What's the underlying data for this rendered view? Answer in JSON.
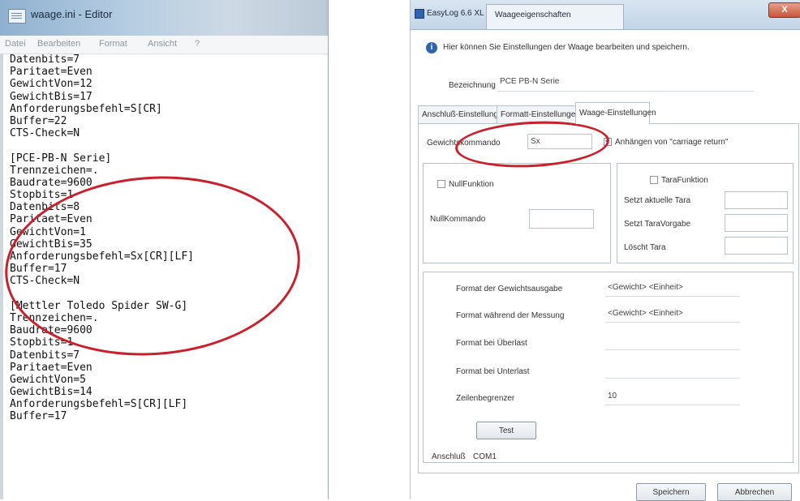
{
  "notepad": {
    "title": "waage.ini - Editor",
    "menu": [
      "Datei",
      "Bearbeiten",
      "Format",
      "Ansicht",
      "?"
    ],
    "lines": [
      "Datenbits=7",
      "Paritaet=Even",
      "GewichtVon=12",
      "GewichtBis=17",
      "Anforderungsbefehl=S[CR]",
      "Buffer=22",
      "CTS-Check=N",
      "",
      "[PCE-PB-N Serie]",
      "Trennzeichen=.",
      "Baudrate=9600",
      "Stopbits=1",
      "Datenbits=8",
      "Paritaet=Even",
      "GewichtVon=1",
      "GewichtBis=35",
      "Anforderungsbefehl=Sx[CR][LF]",
      "Buffer=17",
      "CTS-Check=N",
      "",
      "[Mettler Toledo Spider SW-G]",
      "Trennzeichen=.",
      "Baudrate=9600",
      "Stopbits=1",
      "Datenbits=7",
      "Paritaet=Even",
      "GewichtVon=5",
      "GewichtBis=14",
      "Anforderungsbefehl=S[CR][LF]",
      "Buffer=17"
    ]
  },
  "dialog": {
    "app_title": "EasyLog 6.6 XL",
    "window_title": "Waageeigenschaften",
    "close_label": "X",
    "info_text": "Hier können Sie Einstellungen der Waage bearbeiten und speichern.",
    "bezeichnung_label": "Bezeichnung",
    "bezeichnung_value": "PCE PB-N Serie",
    "tabs": [
      "Anschluß-Einstellungen",
      "Formatt-Einstellungen",
      "Waage-Einstellungen"
    ],
    "gewichtskommando_label": "Gewichtskommando",
    "gewichtskommando_value": "Sx",
    "carriage_return_label": "Anhängen von \"carriage return\"",
    "nullfunktion_label": "NullFunktion",
    "nullkommando_label": "NullKommando",
    "tarafunktion_label": "TaraFunktion",
    "tara_rows": [
      "Setzt aktuelle Tara",
      "Setzt TaraVorgabe",
      "Löscht Tara"
    ],
    "format_rows": [
      {
        "label": "Format der Gewichtsausgabe",
        "value": "<Gewicht> <Einheit>"
      },
      {
        "label": "Format während der Messung",
        "value": "<Gewicht> <Einheit>"
      },
      {
        "label": "Format bei Überlast",
        "value": ""
      },
      {
        "label": "Format bei Unterlast",
        "value": ""
      },
      {
        "label": "Zeilenbegrenzer",
        "value": "10"
      }
    ],
    "test_button": "Test",
    "anschluss_label": "Anschluß",
    "anschluss_value": "COM1",
    "save_button": "Speichern",
    "cancel_button": "Abbrechen"
  },
  "colors": {
    "annotation_red": "#c9202b",
    "accent_blue": "#2e63b0"
  }
}
